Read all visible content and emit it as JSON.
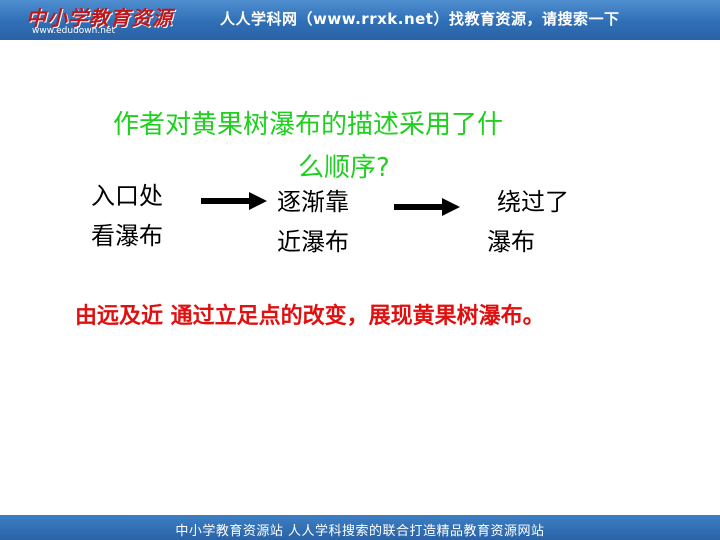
{
  "header": {
    "logo_text": "中小学教育资源",
    "logo_url": "www.edudown.net",
    "banner_text": "人人学科网（www.rrxk.net）找教育资源，请搜索一下"
  },
  "slide": {
    "question_line1": "作者对黄果树瀑布的描述采用了什",
    "question_line2": "么顺序?",
    "steps": [
      {
        "line1": "入口处",
        "line2": "看瀑布"
      },
      {
        "line1": "逐渐靠",
        "line2": "近瀑布"
      },
      {
        "line1": "绕过了",
        "line2": "瀑布"
      }
    ],
    "conclusion": "由远及近 通过立足点的改变，展现黄果树瀑布。"
  },
  "footer": {
    "text": "中小学教育资源站 人人学科搜索的联合打造精品教育资源网站"
  },
  "colors": {
    "question": "#1fd01f",
    "conclusion": "#e01010",
    "banner": "#2f6fb6",
    "arrow": "#000000"
  },
  "icons": {
    "arrow": "arrow-right-icon"
  }
}
